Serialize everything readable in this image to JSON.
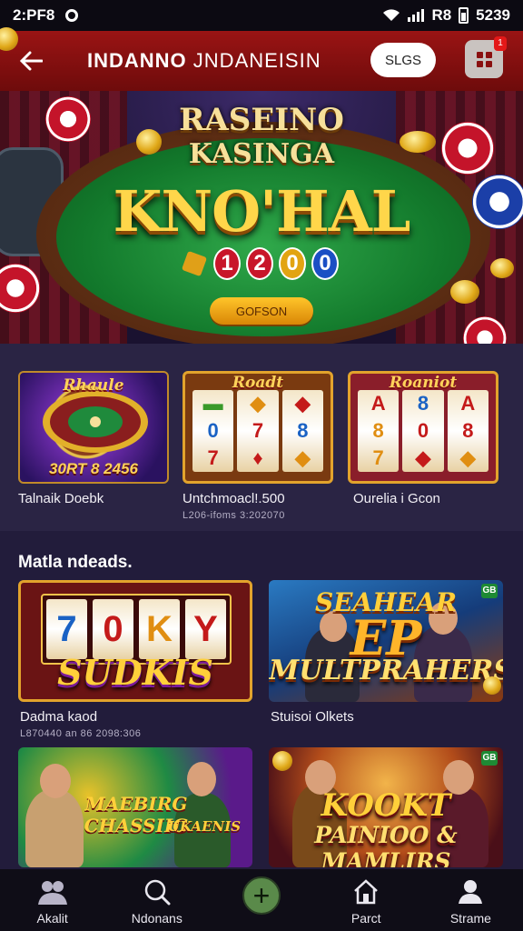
{
  "status_bar": {
    "time": "2:PF8",
    "right_text": "R8",
    "battery": "5239"
  },
  "header": {
    "title_part1": "INDANNO",
    "title_part2": "JNDANEISIN",
    "login_label": "SLGS",
    "notification_count": "1"
  },
  "hero": {
    "crest_line1": "RASEINO",
    "crest_line2": "KASINGA",
    "title": "KNO'HAL",
    "numbers": [
      "1",
      "2",
      "0",
      "0"
    ],
    "button_label": "GOFSON"
  },
  "featured": [
    {
      "tag": "Rhaule",
      "banner": "30RT 8 2456",
      "caption": "Talnaik Doebk",
      "subcaption": ""
    },
    {
      "tag": "Roadt",
      "banner": "",
      "caption": "Untchmoacl!.500",
      "subcaption": "L206-ifoms 3:202070"
    },
    {
      "tag": "Roaniot",
      "banner": "",
      "caption": "Ourelia i Gcon",
      "subcaption": ""
    }
  ],
  "section": {
    "title": "Matla ndeads."
  },
  "games": [
    {
      "reels": [
        "7",
        "0",
        "K",
        "Y"
      ],
      "text1": "SUDKIS",
      "text2": "",
      "text3": "",
      "badge": "",
      "caption": "Dadma kaod",
      "subcaption": "L870440 an 86 2098:306"
    },
    {
      "reels": [],
      "text1": "SEAHEAR",
      "text2": "EP",
      "text3": "MULTPRAHERS",
      "badge": "GB",
      "caption": "Stuisoi Olkets",
      "subcaption": ""
    },
    {
      "reels": [],
      "text1": "MAEBIRG CHASSIIG",
      "text2": "UKAENIS",
      "text3": "",
      "badge": "",
      "caption": "",
      "subcaption": ""
    },
    {
      "reels": [],
      "text1": "KOOKT",
      "text2": "PAINIOO & MAMLIRS",
      "text3": "",
      "badge": "GB",
      "caption": "",
      "subcaption": ""
    }
  ],
  "bottom_nav": {
    "items": [
      {
        "label": "Akalit",
        "icon": "people-icon"
      },
      {
        "label": "Ndonans",
        "icon": "search-icon"
      },
      {
        "label": "",
        "icon": "plus-icon"
      },
      {
        "label": "Parct",
        "icon": "house-icon"
      },
      {
        "label": "Strame",
        "icon": "person-icon"
      }
    ]
  },
  "colors": {
    "header": "#9a1414",
    "background": "#221c3b",
    "accent_gold": "#ffd64a",
    "felt": "#1f8a38"
  }
}
